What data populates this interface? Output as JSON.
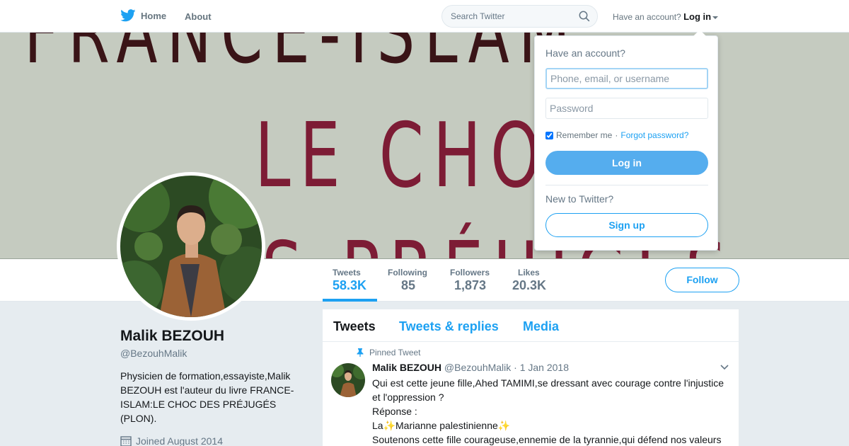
{
  "nav": {
    "home_label": "Home",
    "about_label": "About",
    "search_placeholder": "Search Twitter",
    "have_account": "Have an account?",
    "login_label": "Log in"
  },
  "banner": {
    "line1": "FRANCE-ISLAM",
    "line2": "LE CHOC",
    "line3": "S PRÉJUGÉS"
  },
  "stats": [
    {
      "label": "Tweets",
      "value": "58.3K"
    },
    {
      "label": "Following",
      "value": "85"
    },
    {
      "label": "Followers",
      "value": "1,873"
    },
    {
      "label": "Likes",
      "value": "20.3K"
    }
  ],
  "follow_label": "Follow",
  "profile": {
    "name": "Malik BEZOUH",
    "handle": "@BezouhMalik",
    "bio": "Physicien de formation,essayiste,Malik BEZOUH est l'auteur du livre FRANCE-ISLAM:LE CHOC DES PRÉJUGÉS (PLON).",
    "joined": "Joined August 2014"
  },
  "timeline": {
    "tabs": [
      "Tweets",
      "Tweets & replies",
      "Media"
    ],
    "pinned_label": "Pinned Tweet",
    "tweet": {
      "name": "Malik BEZOUH",
      "handle": "@BezouhMalik",
      "date": "· 1 Jan 2018",
      "line1": "Qui est cette jeune fille,Ahed TAMIMI,se dressant avec courage contre l'injustice et l'oppression ?",
      "line2": "Réponse :",
      "line3_prefix": "La",
      "line3_main": "Marianne palestinienne",
      "line4": "Soutenons cette fille courageuse,ennemie de la tyrannie,qui défend nos valeurs"
    }
  },
  "login_dropdown": {
    "title": "Have an account?",
    "username_placeholder": "Phone, email, or username",
    "password_placeholder": "Password",
    "remember": "Remember me",
    "separator": "·",
    "forgot": "Forgot password?",
    "login_button": "Log in",
    "new_to_twitter": "New to Twitter?",
    "signup_button": "Sign up"
  },
  "colors": {
    "accent": "#1da1f2",
    "login_button_bg": "#55adee",
    "banner_bg": "#c5cbc0",
    "banner_text_dark": "#3a1417",
    "banner_text_red": "#7d1c35"
  },
  "icons": [
    "twitter-bird-icon",
    "search-icon",
    "pin-icon",
    "calendar-icon",
    "chevron-down-icon"
  ]
}
